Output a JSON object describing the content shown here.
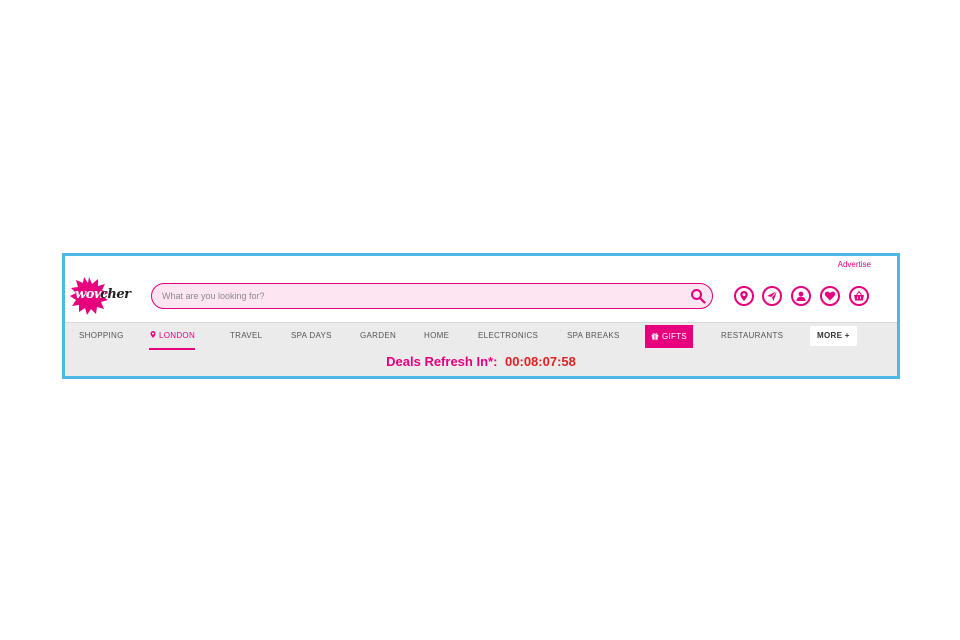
{
  "header": {
    "advertise_link": "Advertise",
    "logo": {
      "part1": "wow",
      "part2": "cher",
      "icon": "wowcher-burst-logo"
    },
    "search": {
      "placeholder": "What are you looking for?",
      "value": "",
      "icon": "search-icon"
    },
    "icons": [
      "location-pin-icon",
      "send-icon",
      "account-icon",
      "heart-icon",
      "basket-icon"
    ]
  },
  "nav": {
    "items": [
      {
        "label": "SHOPPING"
      },
      {
        "label": "LONDON",
        "active": true,
        "icon": "location-pin-icon"
      },
      {
        "label": "TRAVEL"
      },
      {
        "label": "SPA DAYS"
      },
      {
        "label": "GARDEN"
      },
      {
        "label": "HOME"
      },
      {
        "label": "ELECTRONICS"
      },
      {
        "label": "SPA BREAKS"
      },
      {
        "label": "GIFTS",
        "highlighted": true,
        "icon": "gift-icon"
      },
      {
        "label": "RESTAURANTS"
      },
      {
        "label": "MORE +"
      }
    ]
  },
  "countdown": {
    "label": "Deals Refresh In*:",
    "time": "00:08:07:58"
  },
  "colors": {
    "brand": "#e6007e",
    "frame_border": "#4db8e6",
    "nav_bg": "#ebebeb",
    "timer": "#e02020"
  }
}
